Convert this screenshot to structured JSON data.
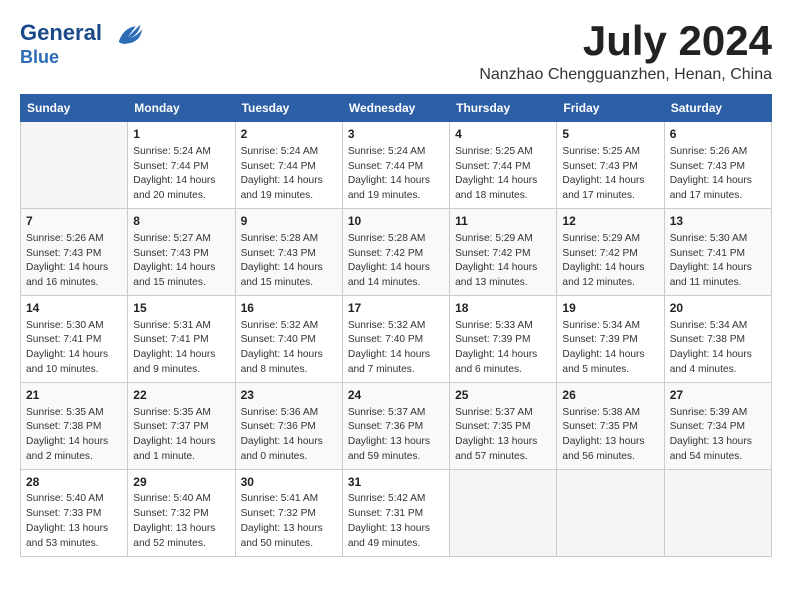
{
  "header": {
    "logo_line1": "General",
    "logo_line2": "Blue",
    "month_title": "July 2024",
    "subtitle": "Nanzhao Chengguanzhen, Henan, China"
  },
  "weekdays": [
    "Sunday",
    "Monday",
    "Tuesday",
    "Wednesday",
    "Thursday",
    "Friday",
    "Saturday"
  ],
  "weeks": [
    [
      {
        "day": "",
        "content": ""
      },
      {
        "day": "1",
        "content": "Sunrise: 5:24 AM\nSunset: 7:44 PM\nDaylight: 14 hours\nand 20 minutes."
      },
      {
        "day": "2",
        "content": "Sunrise: 5:24 AM\nSunset: 7:44 PM\nDaylight: 14 hours\nand 19 minutes."
      },
      {
        "day": "3",
        "content": "Sunrise: 5:24 AM\nSunset: 7:44 PM\nDaylight: 14 hours\nand 19 minutes."
      },
      {
        "day": "4",
        "content": "Sunrise: 5:25 AM\nSunset: 7:44 PM\nDaylight: 14 hours\nand 18 minutes."
      },
      {
        "day": "5",
        "content": "Sunrise: 5:25 AM\nSunset: 7:43 PM\nDaylight: 14 hours\nand 17 minutes."
      },
      {
        "day": "6",
        "content": "Sunrise: 5:26 AM\nSunset: 7:43 PM\nDaylight: 14 hours\nand 17 minutes."
      }
    ],
    [
      {
        "day": "7",
        "content": "Sunrise: 5:26 AM\nSunset: 7:43 PM\nDaylight: 14 hours\nand 16 minutes."
      },
      {
        "day": "8",
        "content": "Sunrise: 5:27 AM\nSunset: 7:43 PM\nDaylight: 14 hours\nand 15 minutes."
      },
      {
        "day": "9",
        "content": "Sunrise: 5:28 AM\nSunset: 7:43 PM\nDaylight: 14 hours\nand 15 minutes."
      },
      {
        "day": "10",
        "content": "Sunrise: 5:28 AM\nSunset: 7:42 PM\nDaylight: 14 hours\nand 14 minutes."
      },
      {
        "day": "11",
        "content": "Sunrise: 5:29 AM\nSunset: 7:42 PM\nDaylight: 14 hours\nand 13 minutes."
      },
      {
        "day": "12",
        "content": "Sunrise: 5:29 AM\nSunset: 7:42 PM\nDaylight: 14 hours\nand 12 minutes."
      },
      {
        "day": "13",
        "content": "Sunrise: 5:30 AM\nSunset: 7:41 PM\nDaylight: 14 hours\nand 11 minutes."
      }
    ],
    [
      {
        "day": "14",
        "content": "Sunrise: 5:30 AM\nSunset: 7:41 PM\nDaylight: 14 hours\nand 10 minutes."
      },
      {
        "day": "15",
        "content": "Sunrise: 5:31 AM\nSunset: 7:41 PM\nDaylight: 14 hours\nand 9 minutes."
      },
      {
        "day": "16",
        "content": "Sunrise: 5:32 AM\nSunset: 7:40 PM\nDaylight: 14 hours\nand 8 minutes."
      },
      {
        "day": "17",
        "content": "Sunrise: 5:32 AM\nSunset: 7:40 PM\nDaylight: 14 hours\nand 7 minutes."
      },
      {
        "day": "18",
        "content": "Sunrise: 5:33 AM\nSunset: 7:39 PM\nDaylight: 14 hours\nand 6 minutes."
      },
      {
        "day": "19",
        "content": "Sunrise: 5:34 AM\nSunset: 7:39 PM\nDaylight: 14 hours\nand 5 minutes."
      },
      {
        "day": "20",
        "content": "Sunrise: 5:34 AM\nSunset: 7:38 PM\nDaylight: 14 hours\nand 4 minutes."
      }
    ],
    [
      {
        "day": "21",
        "content": "Sunrise: 5:35 AM\nSunset: 7:38 PM\nDaylight: 14 hours\nand 2 minutes."
      },
      {
        "day": "22",
        "content": "Sunrise: 5:35 AM\nSunset: 7:37 PM\nDaylight: 14 hours\nand 1 minute."
      },
      {
        "day": "23",
        "content": "Sunrise: 5:36 AM\nSunset: 7:36 PM\nDaylight: 14 hours\nand 0 minutes."
      },
      {
        "day": "24",
        "content": "Sunrise: 5:37 AM\nSunset: 7:36 PM\nDaylight: 13 hours\nand 59 minutes."
      },
      {
        "day": "25",
        "content": "Sunrise: 5:37 AM\nSunset: 7:35 PM\nDaylight: 13 hours\nand 57 minutes."
      },
      {
        "day": "26",
        "content": "Sunrise: 5:38 AM\nSunset: 7:35 PM\nDaylight: 13 hours\nand 56 minutes."
      },
      {
        "day": "27",
        "content": "Sunrise: 5:39 AM\nSunset: 7:34 PM\nDaylight: 13 hours\nand 54 minutes."
      }
    ],
    [
      {
        "day": "28",
        "content": "Sunrise: 5:40 AM\nSunset: 7:33 PM\nDaylight: 13 hours\nand 53 minutes."
      },
      {
        "day": "29",
        "content": "Sunrise: 5:40 AM\nSunset: 7:32 PM\nDaylight: 13 hours\nand 52 minutes."
      },
      {
        "day": "30",
        "content": "Sunrise: 5:41 AM\nSunset: 7:32 PM\nDaylight: 13 hours\nand 50 minutes."
      },
      {
        "day": "31",
        "content": "Sunrise: 5:42 AM\nSunset: 7:31 PM\nDaylight: 13 hours\nand 49 minutes."
      },
      {
        "day": "",
        "content": ""
      },
      {
        "day": "",
        "content": ""
      },
      {
        "day": "",
        "content": ""
      }
    ]
  ]
}
